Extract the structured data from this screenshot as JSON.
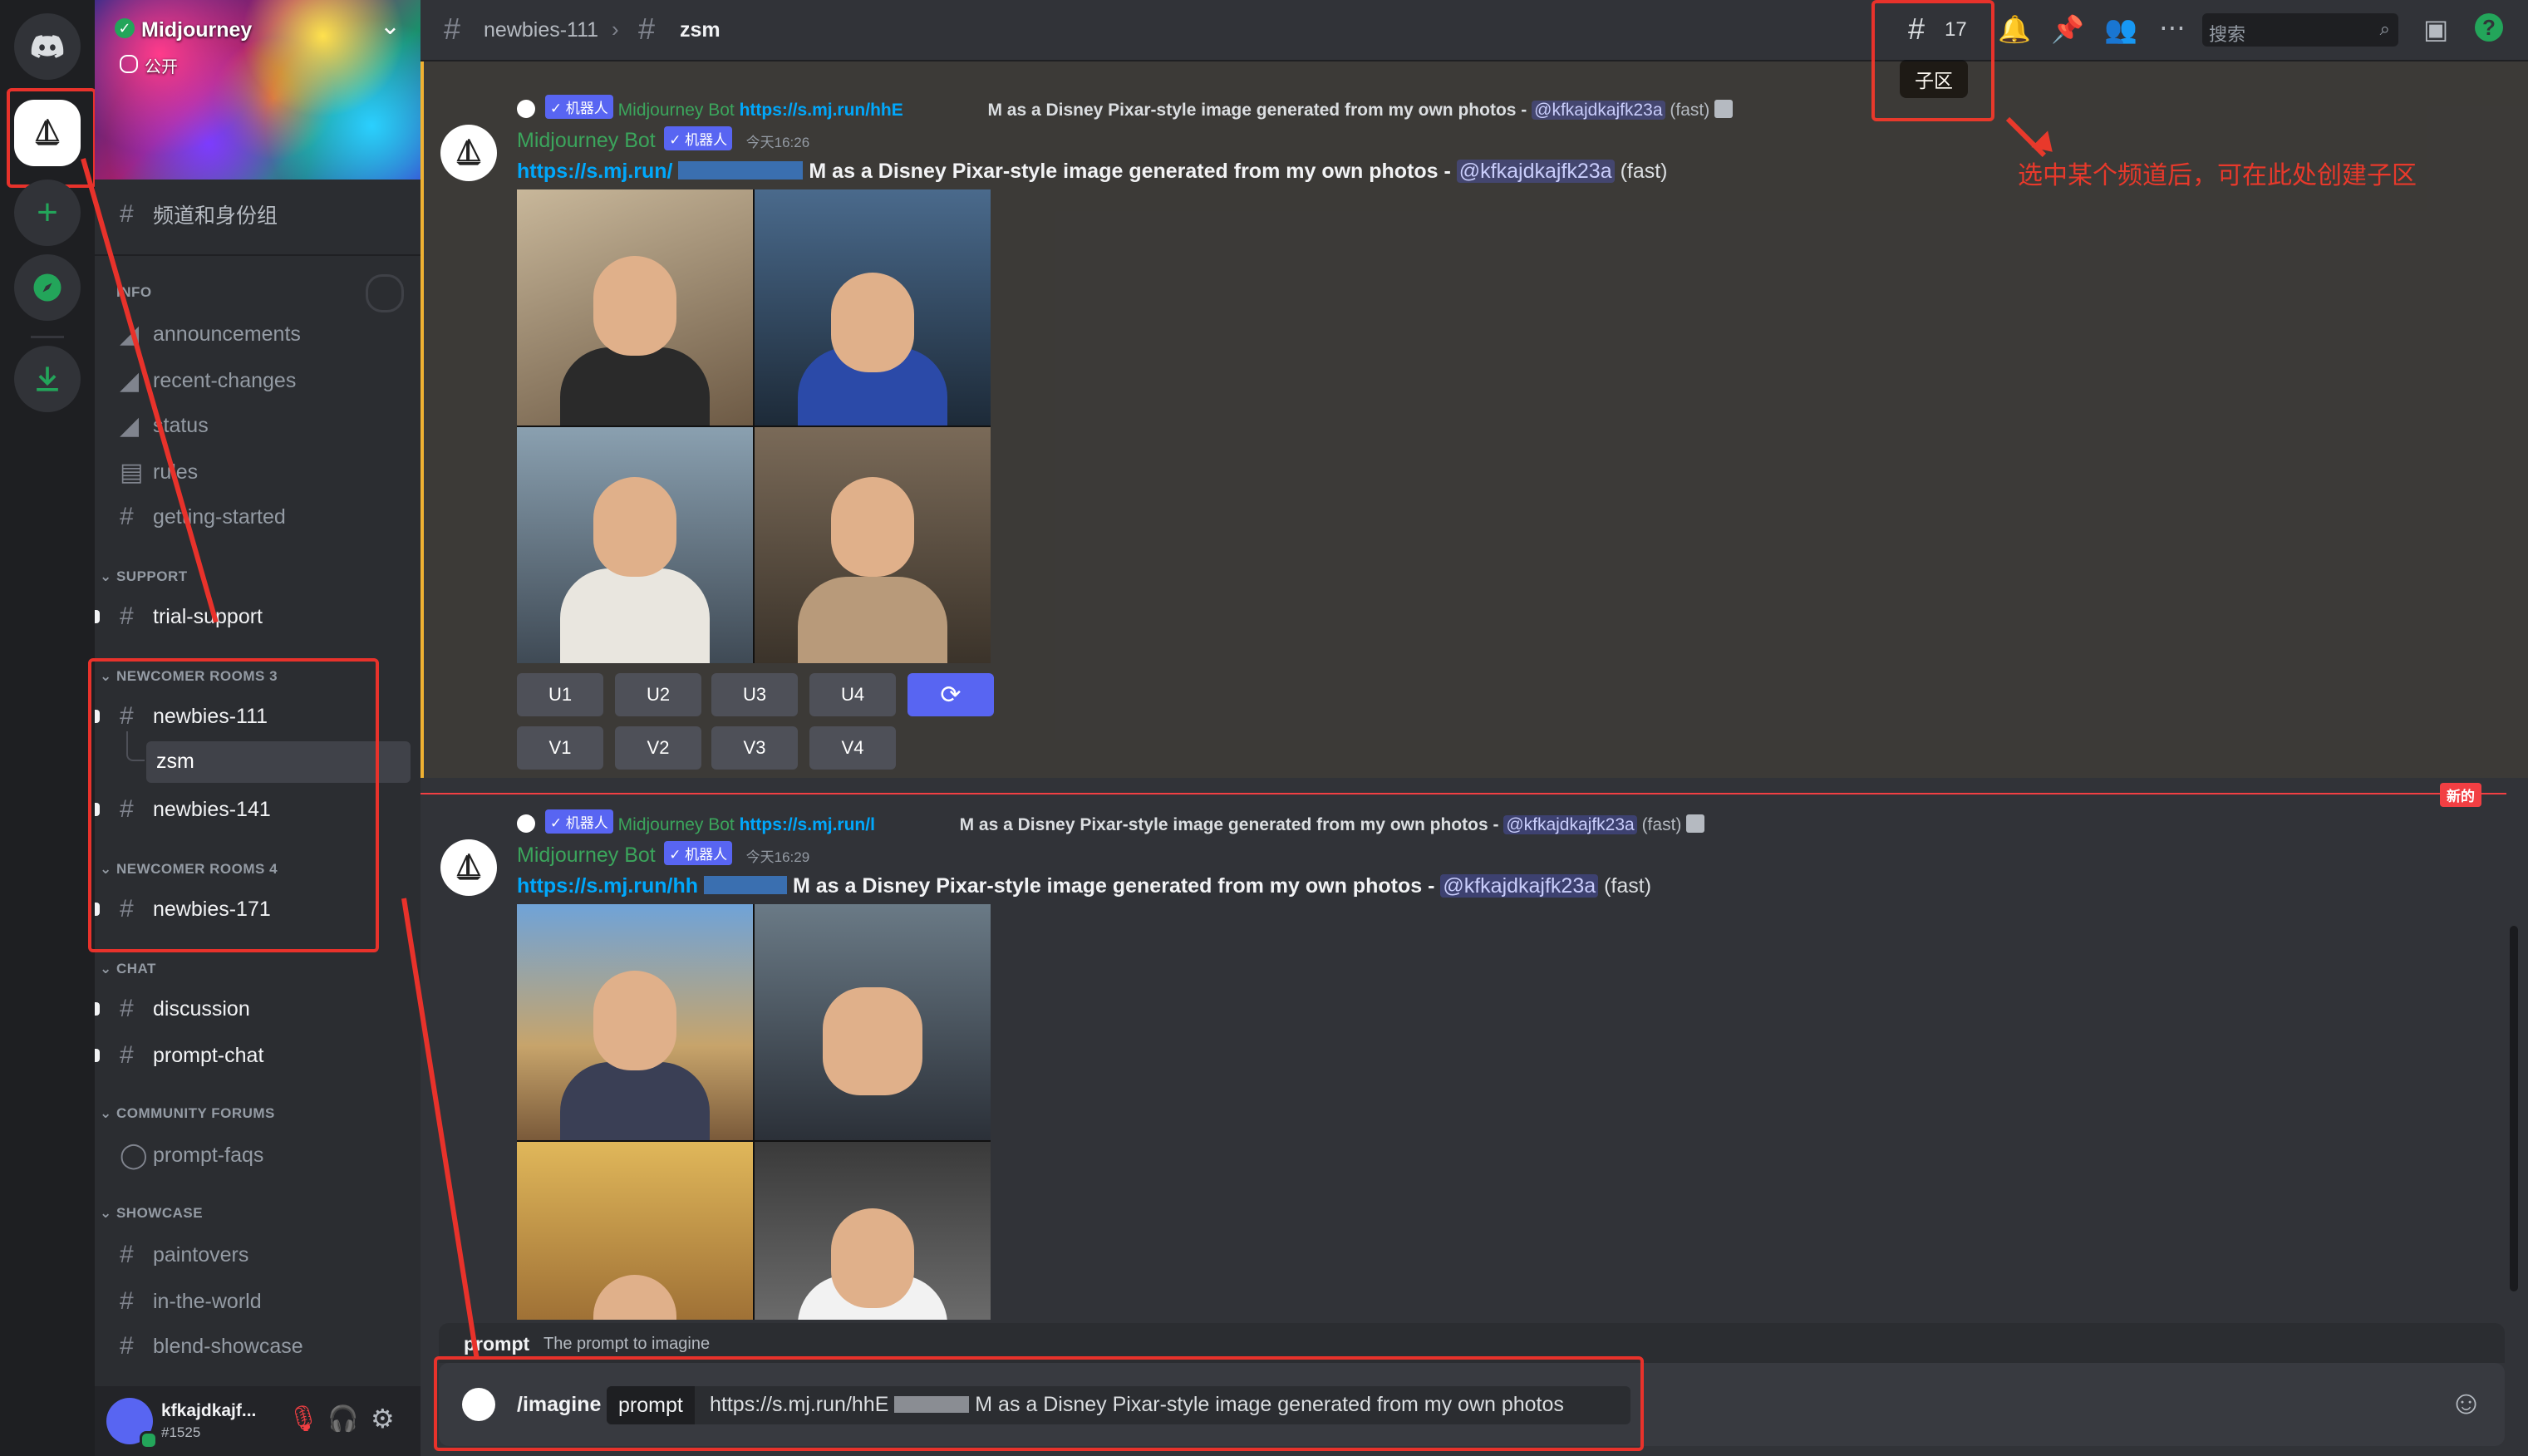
{
  "server": {
    "name": "Midjourney",
    "visibility": "公开"
  },
  "sidebar": {
    "roles_item": "频道和身份组",
    "categories": {
      "info": "INFO",
      "support": "SUPPORT",
      "newcomer3": "NEWCOMER ROOMS 3",
      "newcomer4": "NEWCOMER ROOMS 4",
      "chat": "CHAT",
      "forums": "COMMUNITY FORUMS",
      "showcase": "SHOWCASE"
    },
    "channels": {
      "announcements": "announcements",
      "recent_changes": "recent-changes",
      "status": "status",
      "rules": "rules",
      "getting_started": "getting-started",
      "trial_support": "trial-support",
      "newbies_111": "newbies-111",
      "zsm": "zsm",
      "newbies_141": "newbies-141",
      "newbies_171": "newbies-171",
      "discussion": "discussion",
      "prompt_chat": "prompt-chat",
      "prompt_faqs": "prompt-faqs",
      "paintovers": "paintovers",
      "in_the_world": "in-the-world",
      "blend_showcase": "blend-showcase"
    }
  },
  "user": {
    "name": "kfkajdkajf...",
    "tag": "#1525"
  },
  "header": {
    "channel": "newbies-111",
    "thread": "zsm",
    "threads_count": "17",
    "threads_tooltip": "子区",
    "search_placeholder": "搜索"
  },
  "annotation": "选中某个频道后，可在此处创建子区",
  "messages": [
    {
      "reply_author": "Midjourney Bot",
      "reply_link": "https://s.mj.run/hhE",
      "reply_tail": "M as a Disney Pixar-style image generated from my own photos -",
      "reply_mention": "@kfkajdkajfk23a",
      "reply_speed": "(fast)",
      "author": "Midjourney Bot",
      "bot_tag": "✓ 机器人",
      "time": "今天16:26",
      "link": "https://s.mj.run/",
      "body": "M as a Disney Pixar-style image generated from my own photos -",
      "mention": "@kfkajdkajfk23a",
      "speed": "(fast)",
      "buttons_u": [
        "U1",
        "U2",
        "U3",
        "U4"
      ],
      "buttons_v": [
        "V1",
        "V2",
        "V3",
        "V4"
      ]
    },
    {
      "reply_author": "Midjourney Bot",
      "reply_link": "https://s.mj.run/l",
      "reply_tail": "M as a Disney Pixar-style image generated from my own photos -",
      "reply_mention": "@kfkajdkajfk23a",
      "reply_speed": "(fast)",
      "author": "Midjourney Bot",
      "bot_tag": "✓ 机器人",
      "time": "今天16:29",
      "link": "https://s.mj.run/hh",
      "body": "M as a Disney Pixar-style image generated from my own photos -",
      "mention": "@kfkajdkajfk23a",
      "speed": "(fast)"
    }
  ],
  "new_badge": "新的",
  "bot_chip": "✓ 机器人",
  "prompt_hint": {
    "label": "prompt",
    "desc": "The prompt to imagine"
  },
  "composer": {
    "command": "/imagine",
    "option": "prompt",
    "value_link": "https://s.mj.run/hhE",
    "value_tail": "M as a Disney Pixar-style image generated from my own photos"
  },
  "colors": {
    "accent": "#5865f2",
    "annotation_red": "#e8322b",
    "online": "#23a55a"
  }
}
